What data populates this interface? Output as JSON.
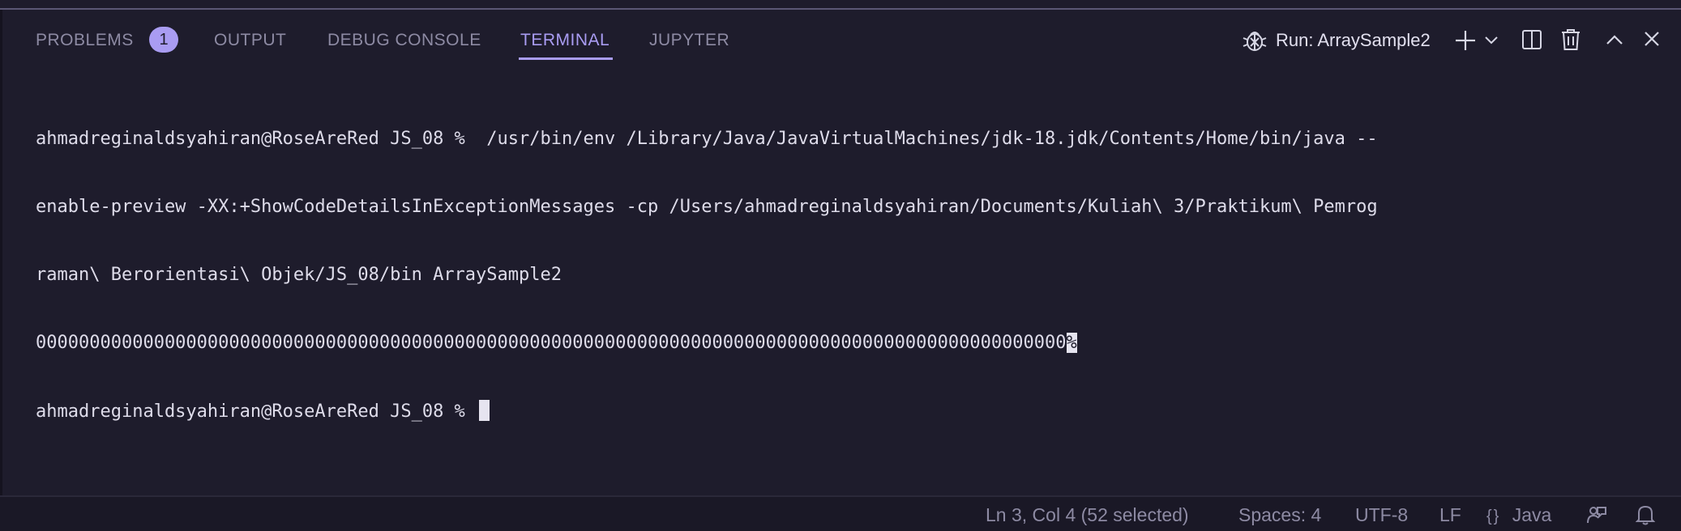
{
  "panel": {
    "tabs": [
      {
        "label": "PROBLEMS",
        "badge": "1"
      },
      {
        "label": "OUTPUT"
      },
      {
        "label": "DEBUG CONSOLE"
      },
      {
        "label": "TERMINAL",
        "active": true
      },
      {
        "label": "JUPYTER"
      }
    ],
    "run_label": "Run: ArraySample2",
    "accent_color": "#a99cf2",
    "icons": [
      "bug-icon",
      "plus-icon",
      "chevron-down-icon",
      "split-icon",
      "trash-icon",
      "chevron-up-icon",
      "close-icon"
    ]
  },
  "terminal": {
    "lines": [
      "ahmadreginaldsyahiran@RoseAreRed JS_08 %  /usr/bin/env /Library/Java/JavaVirtualMachines/jdk-18.jdk/Contents/Home/bin/java --",
      "enable-preview -XX:+ShowCodeDetailsInExceptionMessages -cp /Users/ahmadreginaldsyahiran/Documents/Kuliah\\ 3/Praktikum\\ Pemrog",
      "raman\\ Berorientasi\\ Objek/JS_08/bin ArraySample2"
    ],
    "output_line": "000000000000000000000000000000000000000000000000000000000000000000000000000000000000000000000000",
    "output_end_marker": "%",
    "prompt_line": "ahmadreginaldsyahiran@RoseAreRed JS_08 % "
  },
  "statusbar": {
    "position": "Ln 3, Col 4 (52 selected)",
    "spaces": "Spaces: 4",
    "encoding": "UTF-8",
    "eol": "LF",
    "language_braces": "{}",
    "language": "Java"
  }
}
